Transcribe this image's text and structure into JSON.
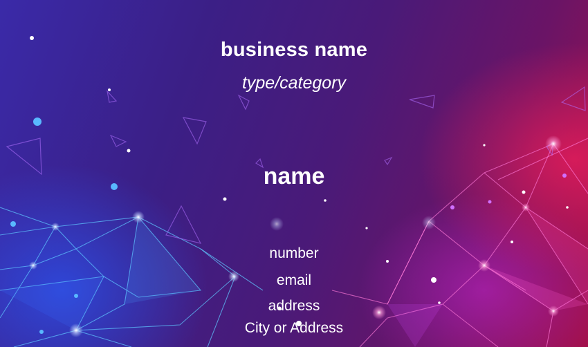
{
  "card": {
    "business_name": "business name",
    "category": "type/category",
    "person_name": "name",
    "number": "number",
    "email": "email",
    "address": "address",
    "city": "City or Address"
  },
  "colors": {
    "background_start": "#3a2aa8",
    "background_end": "#a3104a",
    "accent_blue": "#3a8cff",
    "accent_magenta": "#e040c8",
    "text": "#ffffff"
  }
}
